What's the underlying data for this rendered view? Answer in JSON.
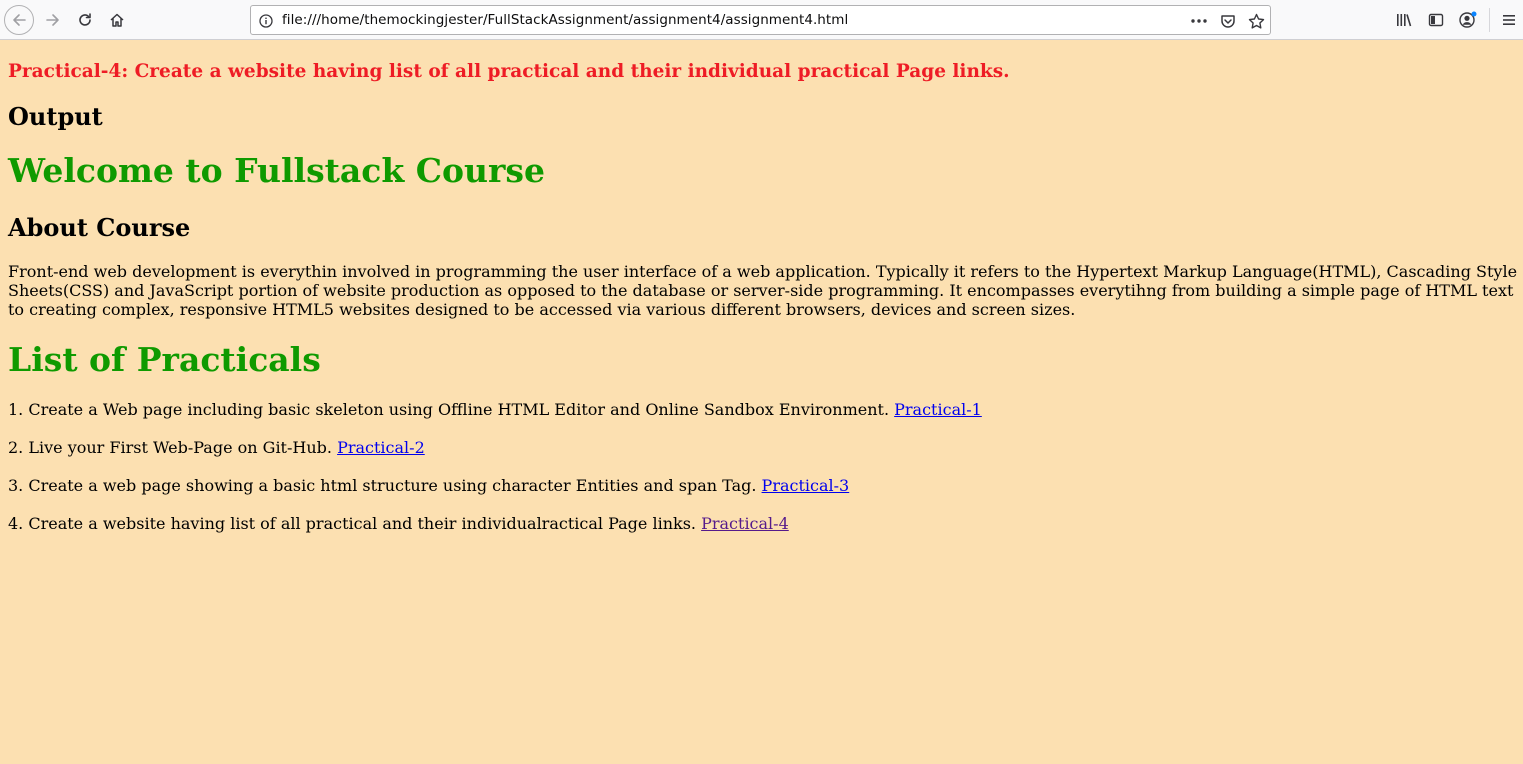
{
  "browser": {
    "url": "file:///home/themockingjester/FullStackAssignment/assignment4/assignment4.html",
    "accent_dot_color": "#0a84ff",
    "icons": {
      "back": "back-arrow-icon",
      "forward": "forward-arrow-icon",
      "reload": "reload-icon",
      "home": "home-icon",
      "info": "info-icon",
      "more": "more-dots-icon",
      "pocket": "pocket-icon",
      "bookmark": "star-icon",
      "library": "library-icon",
      "sidebar": "sidebar-icon",
      "account": "account-icon",
      "menu": "hamburger-menu-icon"
    }
  },
  "page": {
    "background": "#fce0b1",
    "assignment_title": "Practical-4: Create a website having list of all practical and their individual practical Page links.",
    "output_heading": "Output",
    "welcome_heading": "Welcome to Fullstack Course",
    "about_heading": "About Course",
    "about_text": "Front-end web development is everythin involved in programming the user interface of a web application. Typically it refers to the Hypertext Markup Language(HTML), Cascading Style Sheets(CSS) and JavaScript portion of website production as opposed to the database or server-side programming. It encompasses everytihng from building a simple page of HTML text to creating complex, responsive HTML5 websites designed to be accessed via various different browsers, devices and screen sizes.",
    "list_heading": "List of Practicals",
    "colors": {
      "title_red": "#ee1c25",
      "heading_green": "#0f9a00",
      "link": "#0000ee",
      "visited_link": "#551a8b"
    },
    "practicals": [
      {
        "text": "1. Create a Web page including basic skeleton using Offline HTML Editor and Online Sandbox Environment.",
        "link": "Practical-1"
      },
      {
        "text": "2. Live your First Web-Page on Git-Hub.",
        "link": "Practical-2"
      },
      {
        "text": "3. Create a web page showing a basic html structure using character Entities and span Tag.",
        "link": "Practical-3"
      },
      {
        "text": "4. Create a website having list of all practical and their individualractical Page links.",
        "link": "Practical-4"
      }
    ]
  }
}
